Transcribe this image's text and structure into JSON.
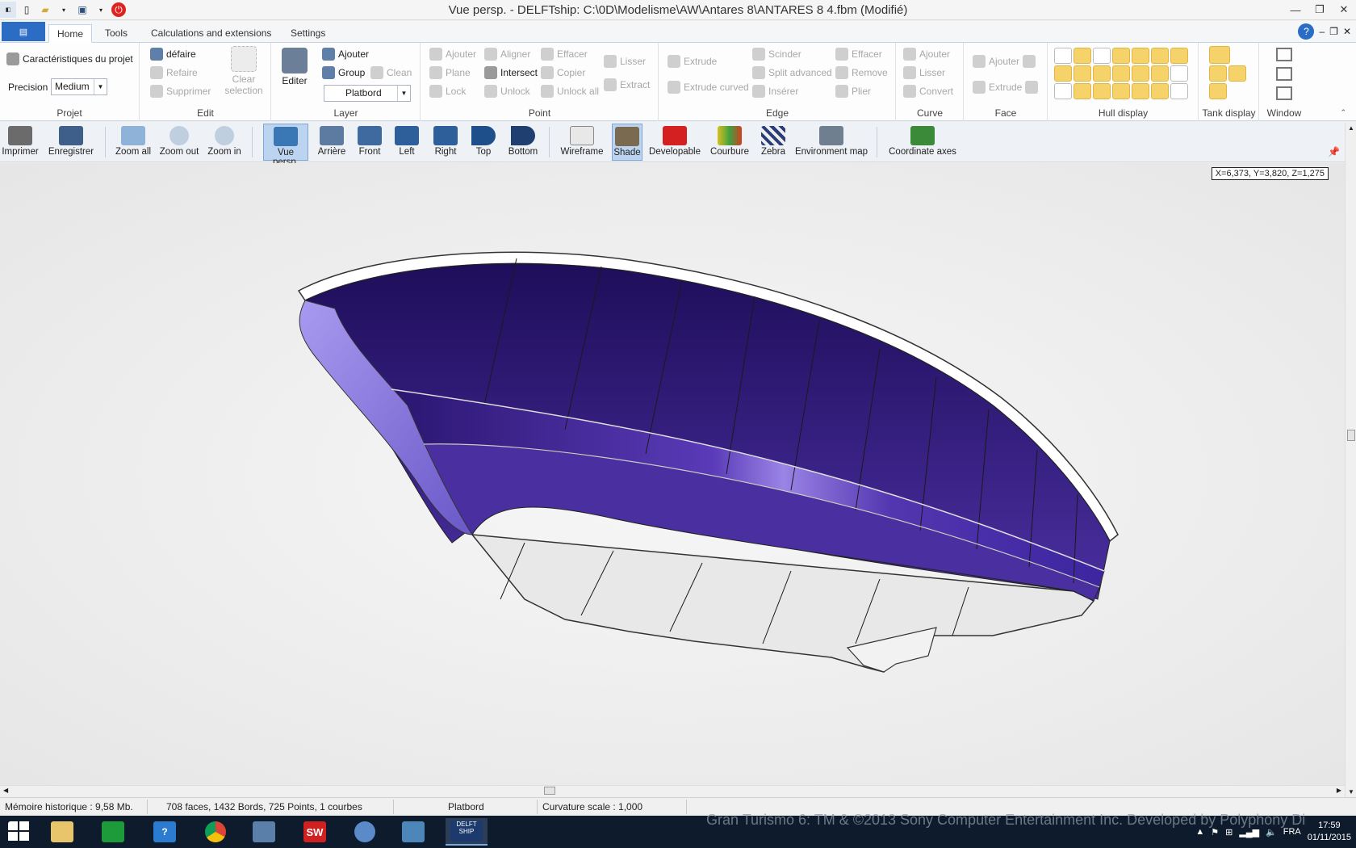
{
  "window": {
    "title": "Vue persp. - DELFTship: C:\\0D\\Modelisme\\AW\\Antares 8\\ANTARES 8 4.fbm (Modifié)",
    "controls": [
      "—",
      "❐",
      "✕"
    ]
  },
  "ribbon_tabs": [
    "Home",
    "Tools",
    "Calculations and extensions",
    "Settings"
  ],
  "groups": {
    "projet": {
      "label": "Projet",
      "caracteristiques": "Caractéristiques du projet",
      "precision_label": "Precision",
      "precision_value": "Medium"
    },
    "edit": {
      "label": "Edit",
      "defaire": "défaire",
      "refaire": "Refaire",
      "supprimer": "Supprimer",
      "clear_selection_1": "Clear",
      "clear_selection_2": "selection"
    },
    "layer": {
      "label": "Layer",
      "editer": "Editer",
      "ajouter": "Ajouter",
      "group": "Group",
      "clean": "Clean",
      "layer_value": "Platbord"
    },
    "point": {
      "label": "Point",
      "ajouter": "Ajouter",
      "aligner": "Aligner",
      "effacer": "Effacer",
      "lisser": "Lisser",
      "plane": "Plane",
      "intersect": "Intersect",
      "copier": "Copier",
      "extract": "Extract",
      "lock": "Lock",
      "unlock": "Unlock",
      "unlock_all": "Unlock all"
    },
    "edge": {
      "label": "Edge",
      "extrude": "Extrude",
      "extrude_curved": "Extrude curved",
      "scinder": "Scinder",
      "split_advanced": "Split advanced",
      "inserer": "Insérer",
      "effacer": "Effacer",
      "remove": "Remove",
      "plier": "Plier"
    },
    "curve": {
      "label": "Curve",
      "ajouter": "Ajouter",
      "lisser": "Lisser",
      "convert": "Convert"
    },
    "face": {
      "label": "Face",
      "ajouter": "Ajouter",
      "extrude": "Extrude"
    },
    "hull_display": {
      "label": "Hull display"
    },
    "tank_display": {
      "label": "Tank display"
    },
    "window": {
      "label": "Window"
    }
  },
  "toolbar": [
    "Imprimer",
    "Enregistrer",
    "Zoom all",
    "Zoom out",
    "Zoom in",
    "Vue persp.",
    "Arrière",
    "Front",
    "Left",
    "Right",
    "Top",
    "Bottom",
    "Wireframe",
    "Shade",
    "Developable",
    "Courbure",
    "Zebra",
    "Environment map",
    "Coordinate axes"
  ],
  "viewport": {
    "coords": "X=6,373, Y=3,820, Z=1,275"
  },
  "statusbar": {
    "memory": "Mémoire historique : 9,58 Mb.",
    "stats": "708 faces, 1432 Bords, 725 Points, 1 courbes",
    "layer": "Platbord",
    "curvature": "Curvature scale : 1,000"
  },
  "taskbar": {
    "watermark": "Gran Turismo 6: TM & ©2013 Sony Computer Entertainment Inc. Developed by Polyphony Di",
    "lang": "FRA",
    "time": "17:59",
    "date": "01/11/2015",
    "delftship_label_1": "DELFT",
    "delftship_label_2": "SHIP",
    "sw_label": "SW",
    "help_label": "?"
  },
  "colors": {
    "hull_purple": "#4a2fa0",
    "hull_highlight": "#9c86e8",
    "accent_blue": "#2b6cc4"
  }
}
